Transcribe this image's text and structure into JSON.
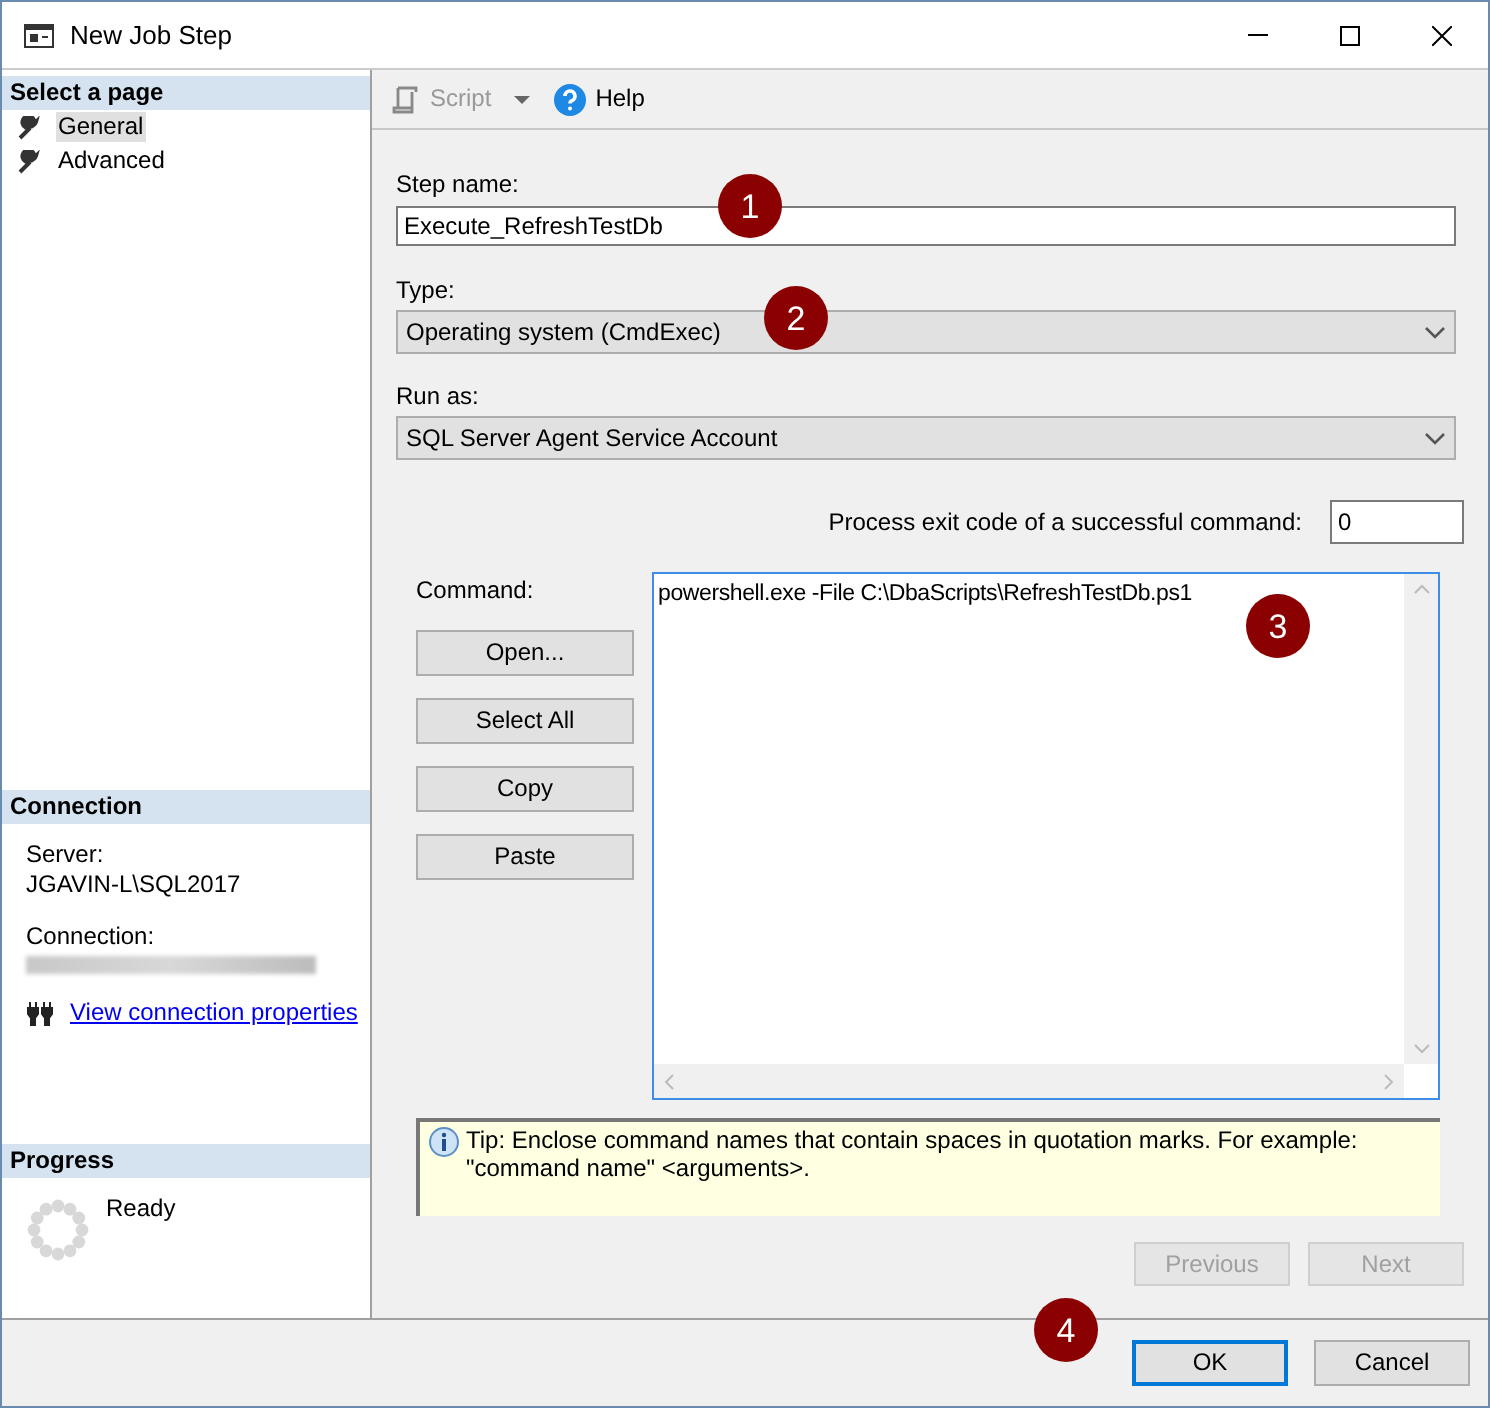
{
  "window": {
    "title": "New Job Step"
  },
  "sidebar": {
    "header": "Select a page",
    "items": [
      {
        "label": "General",
        "selected": true
      },
      {
        "label": "Advanced",
        "selected": false
      }
    ]
  },
  "connection": {
    "header": "Connection",
    "server_label": "Server:",
    "server": "JGAVIN-L\\SQL2017",
    "connection_label": "Connection:",
    "link": "View connection properties"
  },
  "progress": {
    "header": "Progress",
    "status": "Ready"
  },
  "toolbar": [
    {
      "label": "Script",
      "kind": "script",
      "disabled": true
    },
    {
      "label": "Help",
      "kind": "help",
      "disabled": false
    }
  ],
  "form": {
    "step_name_label": "Step name:",
    "step_name": "Execute_RefreshTestDb",
    "type_label": "Type:",
    "type": "Operating system (CmdExec)",
    "run_as_label": "Run as:",
    "run_as": "SQL Server Agent Service Account",
    "exit_code_label": "Process exit code of a successful command:",
    "exit_code": "0",
    "command_label": "Command:",
    "command": "powershell.exe -File C:\\DbaScripts\\RefreshTestDb.ps1"
  },
  "command_buttons": [
    "Open...",
    "Select All",
    "Copy",
    "Paste"
  ],
  "tip": "Tip: Enclose command names that contain spaces in quotation marks. For example: \"command name\" <arguments>.",
  "nav_buttons": [
    {
      "label": "Previous",
      "disabled": true
    },
    {
      "label": "Next",
      "disabled": true
    }
  ],
  "dialog_buttons": [
    {
      "label": "OK",
      "selected": true
    },
    {
      "label": "Cancel",
      "selected": false
    }
  ],
  "callouts": [
    "1",
    "2",
    "3",
    "4"
  ]
}
